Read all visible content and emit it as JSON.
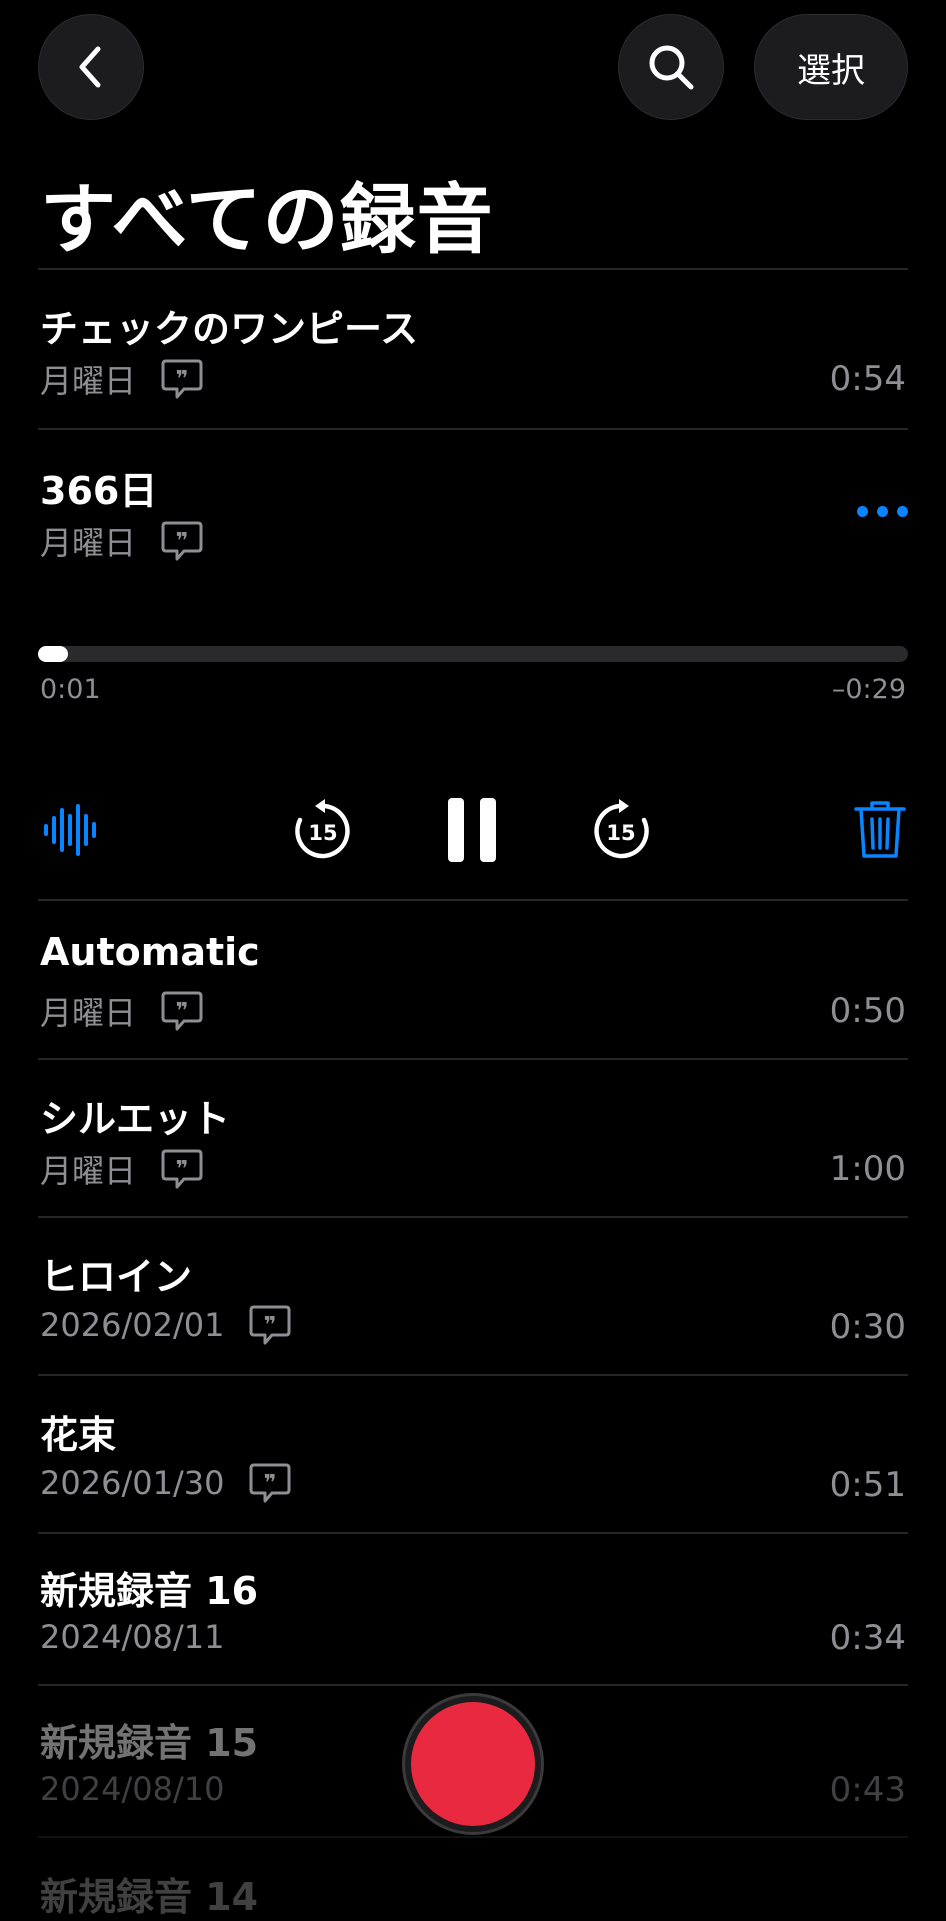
{
  "header": {
    "back_icon": "chevron-left-icon",
    "search_icon": "search-icon",
    "select_label": "選択",
    "title": "すべての録音"
  },
  "recordings": [
    {
      "title": "チェックのワンピース",
      "date": "月曜日",
      "transcript_icon": true,
      "duration": "0:54"
    },
    {
      "title": "366日",
      "date": "月曜日",
      "transcript_icon": true,
      "expanded": true
    },
    {
      "title": "Automatic",
      "date": "月曜日",
      "transcript_icon": true,
      "duration": "0:50"
    },
    {
      "title": "シルエット",
      "date": "月曜日",
      "transcript_icon": true,
      "duration": "1:00"
    },
    {
      "title": "ヒロイン",
      "date": "2026/02/01",
      "transcript_icon": true,
      "duration": "0:30"
    },
    {
      "title": "花束",
      "date": "2026/01/30",
      "transcript_icon": true,
      "duration": "0:51"
    },
    {
      "title": "新規録音 16",
      "date": "2024/08/11",
      "transcript_icon": false,
      "duration": "0:34"
    },
    {
      "title": "新規録音 15",
      "date": "2024/08/10",
      "transcript_icon": false,
      "duration": "0:43"
    },
    {
      "title": "新規録音 14"
    }
  ],
  "player": {
    "elapsed": "0:01",
    "remaining": "–0:29",
    "progress_fraction": 0.034,
    "skip_back_label": "15",
    "skip_forward_label": "15",
    "icons": [
      "waveform-icon",
      "skip-back-15-icon",
      "pause-icon",
      "skip-forward-15-icon",
      "trash-icon",
      "more-icon"
    ]
  },
  "colors": {
    "accent": "#0a84ff",
    "record": "#e9293f",
    "secondary_text": "#8e8e93",
    "background": "#000000"
  }
}
